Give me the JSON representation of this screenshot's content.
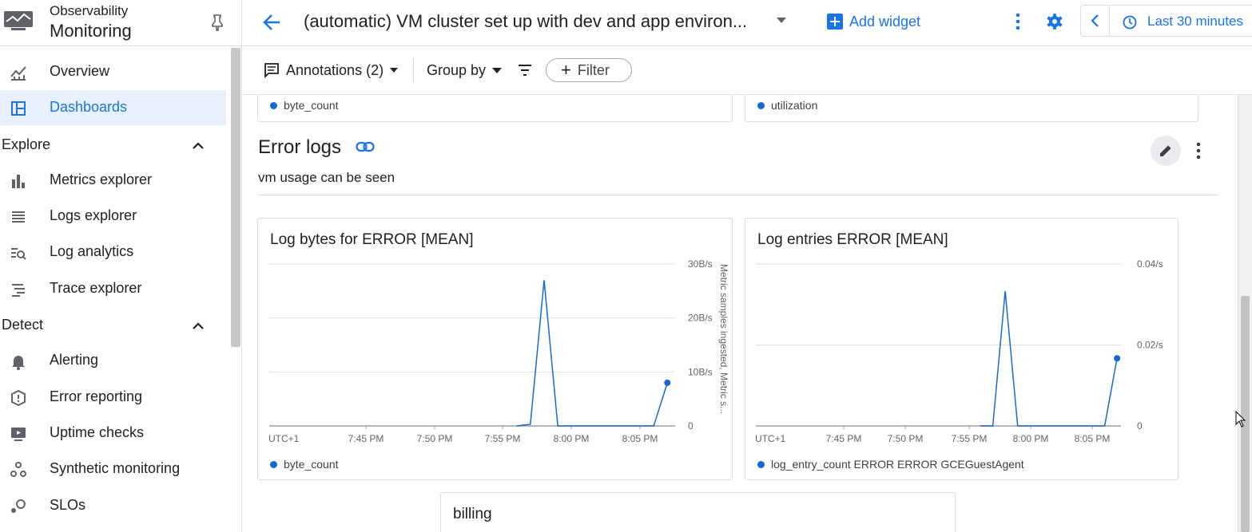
{
  "app": {
    "brand_sup": "Observability",
    "brand_main": "Monitoring"
  },
  "sidebar": {
    "items_top": [
      {
        "label": "Overview",
        "icon": "overview-chart-icon"
      },
      {
        "label": "Dashboards",
        "icon": "dashboards-icon",
        "active": true
      }
    ],
    "explore": {
      "header": "Explore",
      "items": [
        {
          "label": "Metrics explorer",
          "icon": "bar-chart-icon"
        },
        {
          "label": "Logs explorer",
          "icon": "logs-lines-icon"
        },
        {
          "label": "Log analytics",
          "icon": "log-analytics-icon"
        },
        {
          "label": "Trace explorer",
          "icon": "trace-icon"
        }
      ]
    },
    "detect": {
      "header": "Detect",
      "items": [
        {
          "label": "Alerting",
          "icon": "bell-icon"
        },
        {
          "label": "Error reporting",
          "icon": "error-reporting-icon"
        },
        {
          "label": "Uptime checks",
          "icon": "monitor-icon"
        },
        {
          "label": "Synthetic monitoring",
          "icon": "synthetic-icon"
        },
        {
          "label": "SLOs",
          "icon": "slo-icon"
        }
      ]
    }
  },
  "header": {
    "title": "(automatic) VM cluster set up with dev and app environ...",
    "add_widget": "Add widget",
    "time_range": "Last 30 minutes"
  },
  "toolbar": {
    "annotations": "Annotations (2)",
    "group_by": "Group by",
    "filter": "Filter"
  },
  "top_cards": {
    "left_legend": "byte_count",
    "right_legend": "utilization"
  },
  "section": {
    "title": "Error logs",
    "description": "vm usage can be seen"
  },
  "charts": {
    "log_bytes": {
      "title": "Log bytes for ERROR [MEAN]",
      "right_axis_label": "Metric samples ingested, Metric s...",
      "legend": "byte_count"
    },
    "log_entries": {
      "title": "Log entries ERROR [MEAN]",
      "legend": "log_entry_count ERROR ERROR GCEGuestAgent"
    }
  },
  "billing": {
    "title": "billing"
  },
  "chart_data": [
    {
      "type": "line",
      "title": "Log bytes for ERROR [MEAN]",
      "ylabel": "Metric samples ingested, Metric s...",
      "x_ticks": [
        "UTC+1",
        "7:45 PM",
        "7:50 PM",
        "7:55 PM",
        "8:00 PM",
        "8:05 PM"
      ],
      "y_ticks": [
        "0",
        "10B/s",
        "20B/s",
        "30B/s"
      ],
      "ylim": [
        0,
        30
      ],
      "series": [
        {
          "name": "byte_count",
          "x": [
            "7:56 PM",
            "7:57 PM",
            "7:58 PM",
            "7:59 PM",
            "8:00 PM",
            "8:01 PM",
            "8:02 PM",
            "8:03 PM",
            "8:04 PM",
            "8:05 PM",
            "8:06 PM",
            "8:07 PM"
          ],
          "values": [
            0,
            0.3,
            27,
            0,
            0,
            0,
            0,
            0,
            0,
            0,
            0,
            8
          ]
        }
      ],
      "color": "#1967d2"
    },
    {
      "type": "line",
      "title": "Log entries ERROR [MEAN]",
      "x_ticks": [
        "UTC+1",
        "7:45 PM",
        "7:50 PM",
        "7:55 PM",
        "8:00 PM",
        "8:05 PM"
      ],
      "y_ticks": [
        "0",
        "0.02/s",
        "0.04/s"
      ],
      "ylim": [
        0,
        0.04
      ],
      "series": [
        {
          "name": "log_entry_count ERROR ERROR GCEGuestAgent",
          "x": [
            "7:56 PM",
            "7:57 PM",
            "7:58 PM",
            "7:59 PM",
            "8:00 PM",
            "8:01 PM",
            "8:02 PM",
            "8:03 PM",
            "8:04 PM",
            "8:05 PM",
            "8:06 PM",
            "8:07 PM"
          ],
          "values": [
            0,
            0,
            0.0333,
            0,
            0,
            0,
            0,
            0,
            0,
            0,
            0,
            0.0167
          ]
        }
      ],
      "color": "#1967d2"
    }
  ]
}
